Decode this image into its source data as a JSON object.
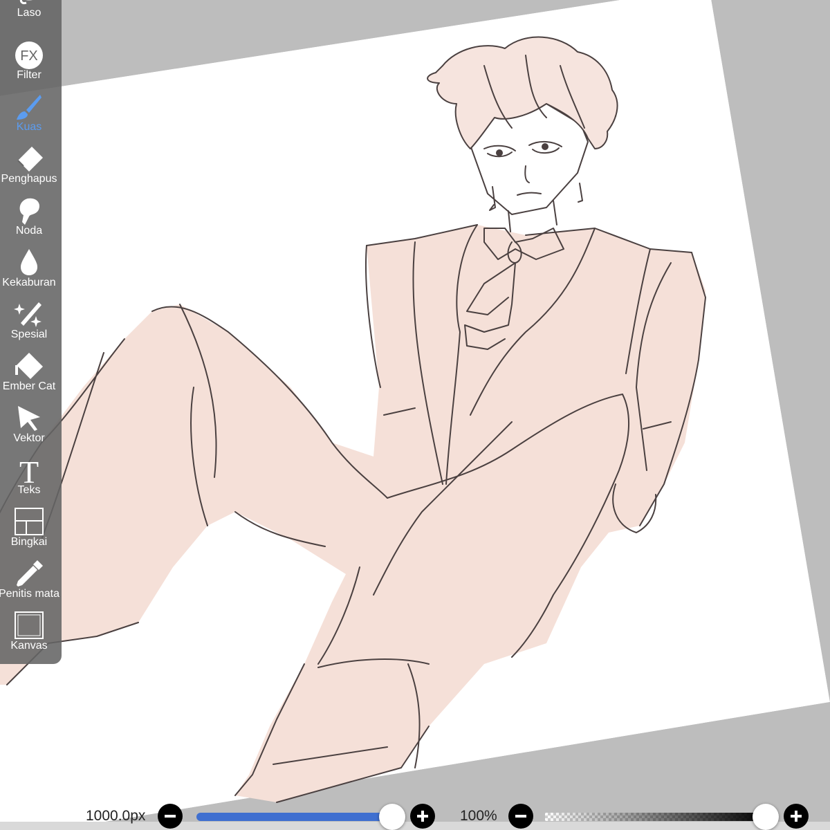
{
  "toolbar": {
    "tools": [
      {
        "label": "Laso",
        "icon": "lasso-icon"
      },
      {
        "label": "Filter",
        "icon": "fx-icon",
        "icon_text": "FX"
      },
      {
        "label": "Kuas",
        "icon": "brush-icon",
        "active": true
      },
      {
        "label": "Penghapus",
        "icon": "eraser-icon"
      },
      {
        "label": "Noda",
        "icon": "smudge-icon"
      },
      {
        "label": "Kekaburan",
        "icon": "blur-drop-icon"
      },
      {
        "label": "Spesial",
        "icon": "magic-wand-icon"
      },
      {
        "label": "Ember Cat",
        "icon": "paint-bucket-icon"
      },
      {
        "label": "Vektor",
        "icon": "vector-arrow-icon"
      },
      {
        "label": "Teks",
        "icon": "text-icon",
        "icon_text": "T"
      },
      {
        "label": "Bingkai",
        "icon": "frame-icon"
      },
      {
        "label": "Penitis mata",
        "icon": "eyedropper-icon"
      },
      {
        "label": "Kanvas",
        "icon": "canvas-icon"
      }
    ]
  },
  "brush_size": {
    "value_text": "1000.0px",
    "level": 1.0
  },
  "opacity": {
    "value_text": "100%",
    "level": 1.0
  },
  "colors": {
    "accent": "#5b9cf0",
    "slider_fill": "#3f6fd0",
    "skin_fill": "#f5e0d8",
    "line_art": "#4a4040",
    "canvas_bg": "#bdbdbd",
    "paper": "#ffffff"
  }
}
